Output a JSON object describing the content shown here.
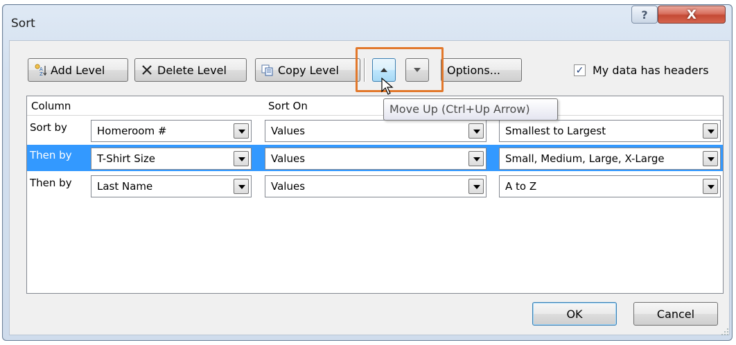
{
  "window": {
    "title": "Sort",
    "help_glyph": "?",
    "close_glyph": "X"
  },
  "toolbar": {
    "add_level": "Add Level",
    "delete_level": "Delete Level",
    "copy_level": "Copy Level",
    "move_up_icon": "up-arrow-icon",
    "move_down_icon": "down-arrow-icon",
    "options": "Options...",
    "headers_checkbox": {
      "label": "My data has headers",
      "checked": true,
      "glyph": "✓"
    }
  },
  "grid": {
    "headers": {
      "column": "Column",
      "sort_on": "Sort On"
    },
    "rows": [
      {
        "label": "Sort by",
        "column": "Homeroom #",
        "sort_on": "Values",
        "order": "Smallest to Largest",
        "selected": false
      },
      {
        "label": "Then by",
        "column": "T-Shirt Size",
        "sort_on": "Values",
        "order": "Small, Medium, Large, X-Large",
        "selected": true
      },
      {
        "label": "Then by",
        "column": "Last Name",
        "sort_on": "Values",
        "order": "A to Z",
        "selected": false
      }
    ]
  },
  "tooltip": {
    "text": "Move Up (Ctrl+Up Arrow)"
  },
  "buttons": {
    "ok": "OK",
    "cancel": "Cancel"
  },
  "colors": {
    "selection": "#3399ff",
    "highlight": "#e2782b"
  }
}
